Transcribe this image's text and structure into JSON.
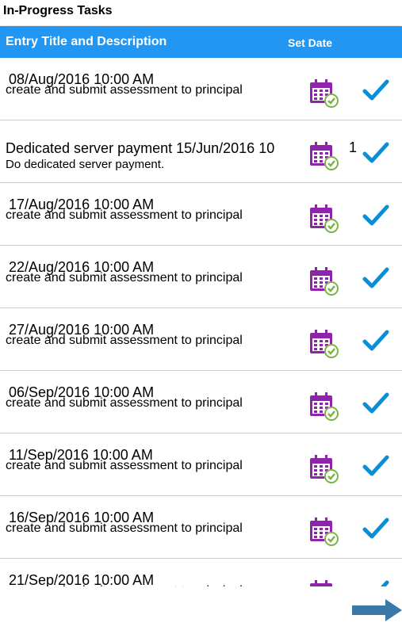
{
  "window": {
    "title": "In-Progress Tasks"
  },
  "table": {
    "header_title": "Entry Title and Description",
    "header_date": "Set Date",
    "rows": [
      {
        "title": "08/Aug/2016 10:00 AM",
        "description": "create and submit assessment to principal"
      },
      {
        "title": "Dedicated server payment 15/Jun/2016 10",
        "description": "Do dedicated server payment.",
        "extra": "1"
      },
      {
        "title": "17/Aug/2016 10:00 AM",
        "description": "create and submit assessment to principal"
      },
      {
        "title": "22/Aug/2016 10:00 AM",
        "description": "create and submit assessment to principal"
      },
      {
        "title": "27/Aug/2016 10:00 AM",
        "description": "create and submit assessment to principal"
      },
      {
        "title": "06/Sep/2016 10:00 AM",
        "description": "create and submit assessment to principal"
      },
      {
        "title": "11/Sep/2016 10:00 AM",
        "description": "create and submit assessment to principal"
      },
      {
        "title": "16/Sep/2016 10:00 AM",
        "description": "create and submit assessment to principal"
      },
      {
        "title": "21/Sep/2016 10:00 AM",
        "description": "create and submit assessment to principal"
      }
    ]
  },
  "icons": {
    "calendar": "calendar-check-icon",
    "check": "checkmark-icon",
    "next": "next-arrow-icon"
  },
  "colors": {
    "header": "#2196f3",
    "calendar": "#8e24aa",
    "calendar_badge": "#7cb342",
    "check": "#0a8fd6",
    "arrow": "#3a78a8"
  }
}
